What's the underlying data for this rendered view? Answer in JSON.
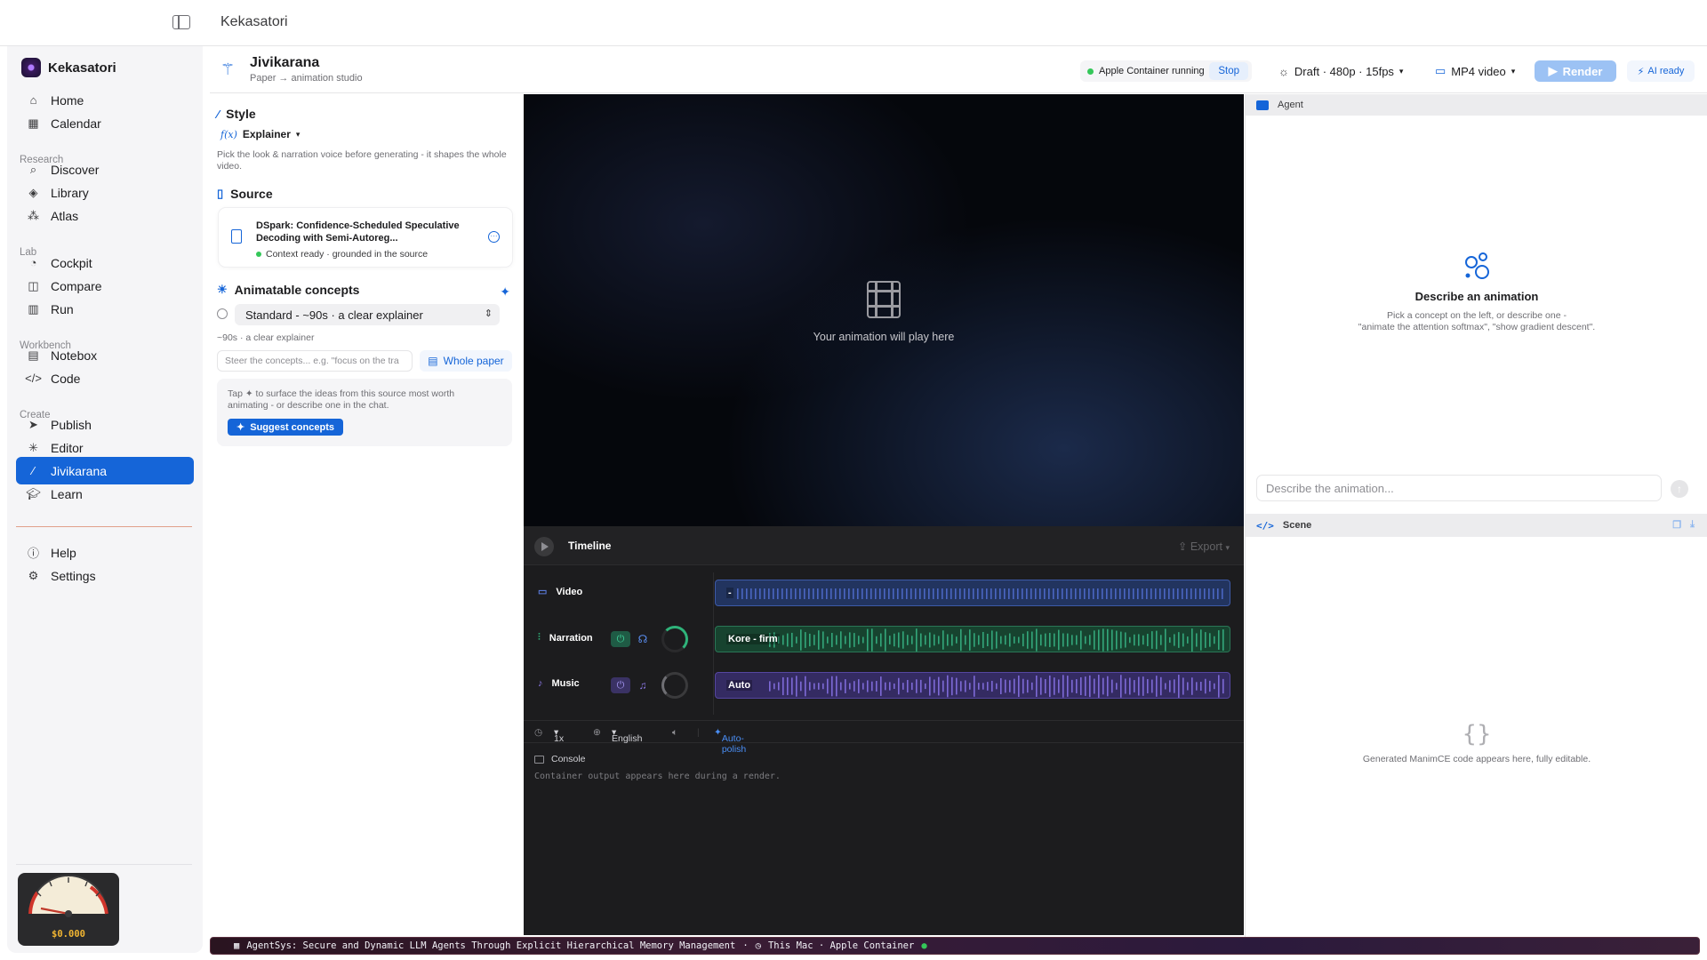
{
  "app": {
    "title": "Kekasatori"
  },
  "sidebar": {
    "brand": "Kekasatori",
    "items_top": [
      {
        "label": "Home",
        "icon": "home-icon"
      },
      {
        "label": "Calendar",
        "icon": "calendar-icon"
      }
    ],
    "sections": {
      "research": "Research",
      "lab": "Lab",
      "workbench": "Workbench",
      "create": "Create"
    },
    "research": [
      {
        "label": "Discover"
      },
      {
        "label": "Library"
      },
      {
        "label": "Atlas"
      }
    ],
    "lab": [
      {
        "label": "Cockpit"
      },
      {
        "label": "Compare"
      },
      {
        "label": "Run"
      }
    ],
    "workbench": [
      {
        "label": "Notebox"
      },
      {
        "label": "Code"
      }
    ],
    "create": [
      {
        "label": "Publish"
      },
      {
        "label": "Editor"
      },
      {
        "label": "Jivikarana"
      },
      {
        "label": "Learn"
      }
    ],
    "bottom": [
      {
        "label": "Help"
      },
      {
        "label": "Settings"
      }
    ],
    "cost": "$0.000",
    "cost_gauge_fraction": 0.0
  },
  "header": {
    "title": "Jivikarana",
    "subtitle": "Paper → animation studio",
    "container_status": "Apple Container running",
    "stop_label": "Stop",
    "quality": "Draft · 480p · 15fps",
    "format": "MP4 video",
    "render_label": "Render",
    "ai_label": "AI ready"
  },
  "left": {
    "style_heading": "Style",
    "style_value": "Explainer",
    "style_hint": "Pick the look & narration voice before generating - it shapes the whole video.",
    "source_heading": "Source",
    "source_title": "DSpark: Confidence-Scheduled Speculative Decoding with Semi-Autoreg...",
    "source_status": "Context ready · grounded in the source",
    "concepts_heading": "Animatable concepts",
    "length_select": "Standard - ~90s · a clear explainer",
    "length_hint": "~90s · a clear explainer",
    "steer_placeholder": "Steer the concepts... e.g. \"focus on the tra",
    "whole_paper": "Whole paper",
    "tap_text": "Tap ✦ to surface the ideas from this source most worth animating - or describe one in the chat.",
    "suggest_label": "Suggest concepts"
  },
  "stage": {
    "placeholder": "Your animation will play here"
  },
  "timeline": {
    "label": "Timeline",
    "export_label": "Export",
    "tracks": [
      {
        "name": "Video",
        "clip": "-",
        "color": "#2b3f80"
      },
      {
        "name": "Narration",
        "clip": "Kore - firm",
        "color": "#1f6a4f"
      },
      {
        "name": "Music",
        "clip": "Auto",
        "color": "#4b3a8a"
      }
    ],
    "speed": "1x",
    "language": "English",
    "autopolish": "Auto-polish",
    "console_label": "Console",
    "console_text": "Container output appears here during a render."
  },
  "agent": {
    "label": "Agent",
    "empty_title": "Describe an animation",
    "empty_line1": "Pick a concept on the left, or describe one -",
    "empty_line2": "\"animate the attention softmax\", \"show gradient descent\".",
    "input_placeholder": "Describe the animation..."
  },
  "scene": {
    "label": "Scene",
    "empty_text": "Generated ManimCE code appears here, fully editable."
  },
  "statusbar": {
    "paper": "AgentSys: Secure and Dynamic LLM Agents Through Explicit Hierarchical Memory Management",
    "machine": "This Mac · Apple Container"
  }
}
